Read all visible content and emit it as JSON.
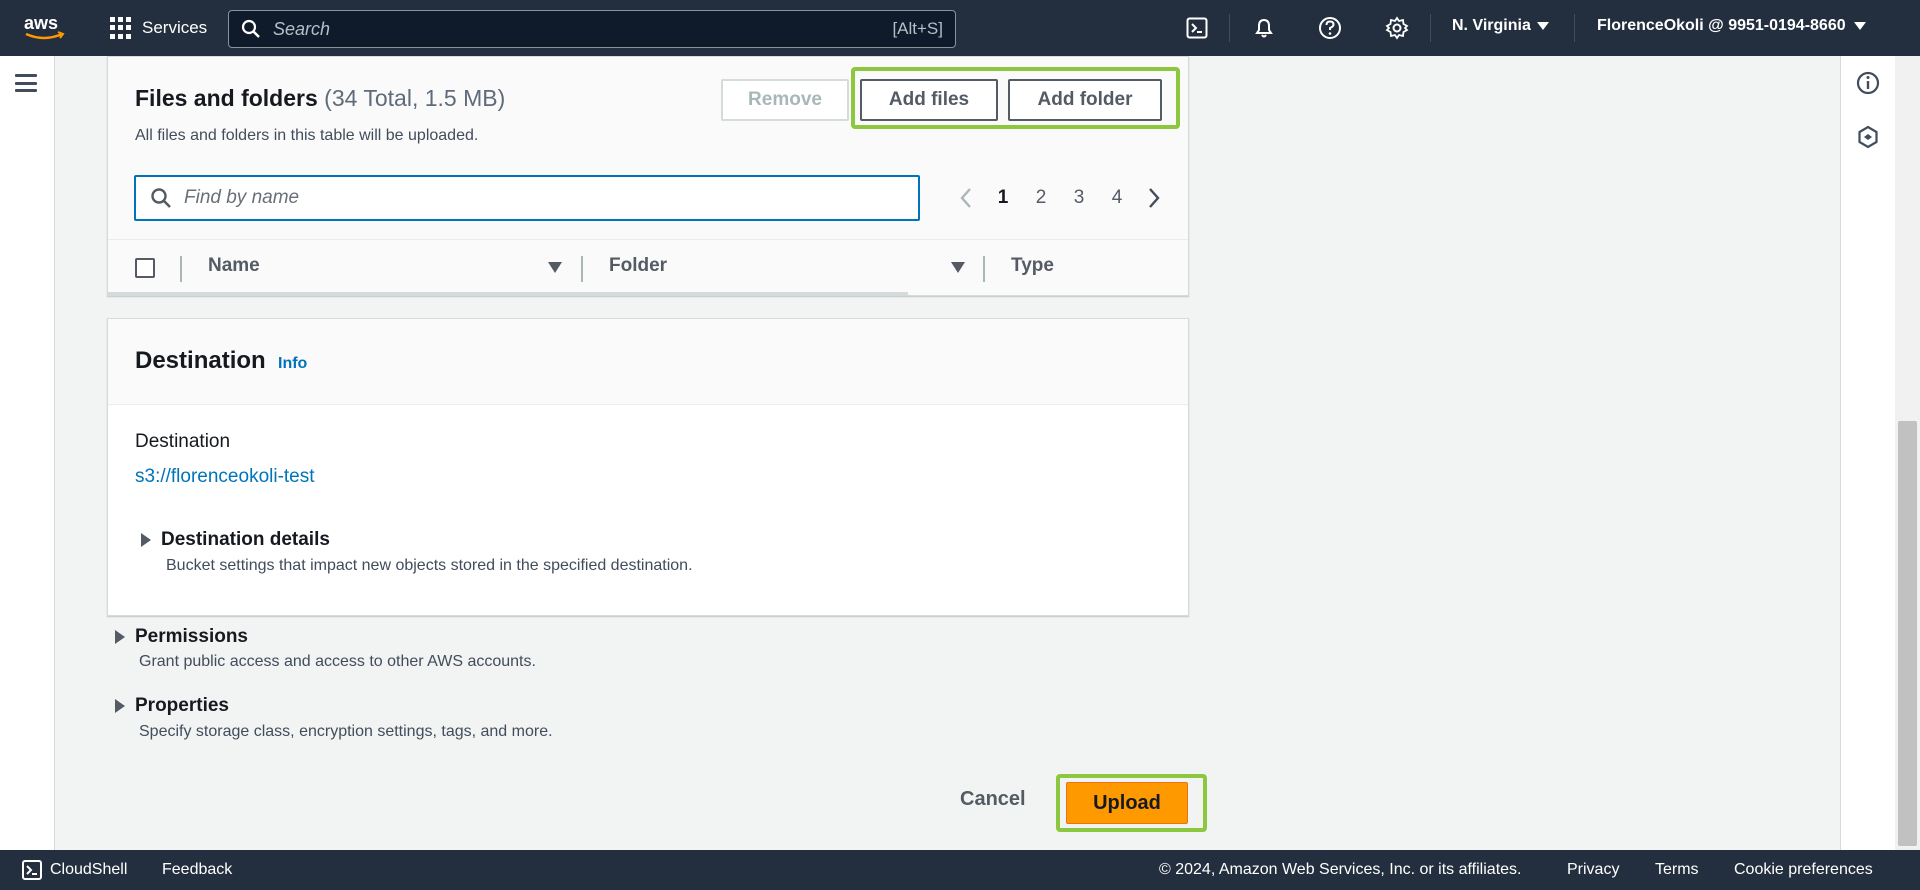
{
  "topnav": {
    "logo_text": "aws",
    "services_label": "Services",
    "search_placeholder": "Search",
    "search_shortcut": "[Alt+S]",
    "region": "N. Virginia",
    "account": "FlorenceOkoli @ 9951-0194-8660",
    "icons": [
      "cloudshell-icon",
      "bell-icon",
      "help-icon",
      "settings-icon"
    ]
  },
  "files": {
    "title": "Files and folders",
    "count": "(34 Total, 1.5 MB)",
    "subtitle": "All files and folders in this table will be uploaded.",
    "remove_label": "Remove",
    "add_files_label": "Add files",
    "add_folder_label": "Add folder",
    "search_placeholder": "Find by name",
    "pages": [
      "1",
      "2",
      "3",
      "4"
    ],
    "current_page": "1",
    "columns": [
      "Name",
      "Folder",
      "Type"
    ]
  },
  "destination": {
    "title": "Destination",
    "info_label": "Info",
    "label": "Destination",
    "value": "s3://florenceokoli-test",
    "details_title": "Destination details",
    "details_desc": "Bucket settings that impact new objects stored in the specified destination."
  },
  "permissions": {
    "title": "Permissions",
    "desc": "Grant public access and access to other AWS accounts."
  },
  "properties": {
    "title": "Properties",
    "desc": "Specify storage class, encryption settings, tags, and more."
  },
  "actions": {
    "cancel_label": "Cancel",
    "upload_label": "Upload"
  },
  "footer": {
    "cloudshell": "CloudShell",
    "feedback": "Feedback",
    "copyright": "© 2024, Amazon Web Services, Inc. or its affiliates.",
    "privacy": "Privacy",
    "terms": "Terms",
    "cookies": "Cookie preferences"
  },
  "colors": {
    "nav_bg": "#232f3e",
    "link": "#0073bb",
    "upload_bg": "#ff9900",
    "highlight": "#8dc63f"
  }
}
